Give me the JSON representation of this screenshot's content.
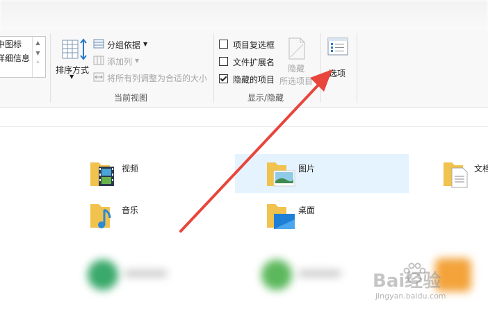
{
  "ribbon": {
    "layout_items": [
      "中图标",
      "详细信息"
    ],
    "current_view": {
      "sort_label": "排序方式",
      "group_by": "分组依据",
      "add_column": "添加列",
      "size_all_columns": "将所有列调整为合适的大小",
      "group_label": "当前视图"
    },
    "show_hide": {
      "checkboxes": [
        {
          "label": "项目复选框",
          "checked": false
        },
        {
          "label": "文件扩展名",
          "checked": false
        },
        {
          "label": "隐藏的项目",
          "checked": true
        }
      ],
      "hide_selected_line1": "隐藏",
      "hide_selected_line2": "所选项目",
      "group_label": "显示/隐藏"
    },
    "options_label": "选项"
  },
  "folders": [
    {
      "name": "视频",
      "icon": "video-folder-icon"
    },
    {
      "name": "图片",
      "icon": "pictures-folder-icon",
      "selected": true
    },
    {
      "name": "文档",
      "icon": "documents-folder-icon"
    },
    {
      "name": "音乐",
      "icon": "music-folder-icon"
    },
    {
      "name": "桌面",
      "icon": "desktop-folder-icon"
    }
  ],
  "annotation": {
    "color": "#e8453c"
  },
  "watermark": {
    "text": "Bai经验",
    "sub": "jingyan.baidu.com"
  }
}
